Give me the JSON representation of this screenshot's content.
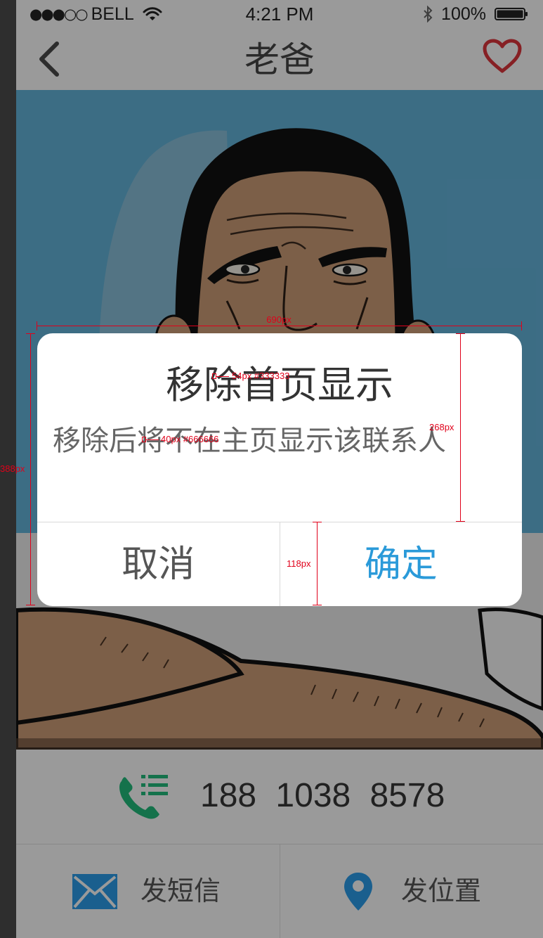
{
  "status_bar": {
    "signal": "●●●○○",
    "carrier": "BELL",
    "time": "4:21 PM",
    "battery": "100%"
  },
  "nav": {
    "title": "老爸"
  },
  "contact": {
    "phone": "188 1038 8578"
  },
  "actions": {
    "sms": "发短信",
    "location": "发位置"
  },
  "dialog": {
    "title": "移除首页显示",
    "message": "移除后将不在主页显示该联系人",
    "cancel": "取消",
    "confirm": "确定"
  },
  "annotations": {
    "measurements": [
      "690px",
      "388px",
      "268px",
      "118px"
    ],
    "text_specs": [
      "54px #333333",
      "40px #666666"
    ]
  },
  "icons": {
    "wifi": "wifi-icon",
    "bluetooth": "bluetooth-icon",
    "battery": "battery-icon",
    "back": "chevron-left-icon",
    "favorite": "heart-icon",
    "call": "phone-list-icon",
    "sms": "envelope-icon",
    "location": "location-pin-icon"
  },
  "colors": {
    "favorite": "#d8343a",
    "call_icon": "#21b97a",
    "action_icons": "#2a9ae6",
    "confirm_text": "#2a9ad9",
    "dialog_title": "#333333",
    "dialog_message": "#666666",
    "annotation": "#e0001a"
  }
}
